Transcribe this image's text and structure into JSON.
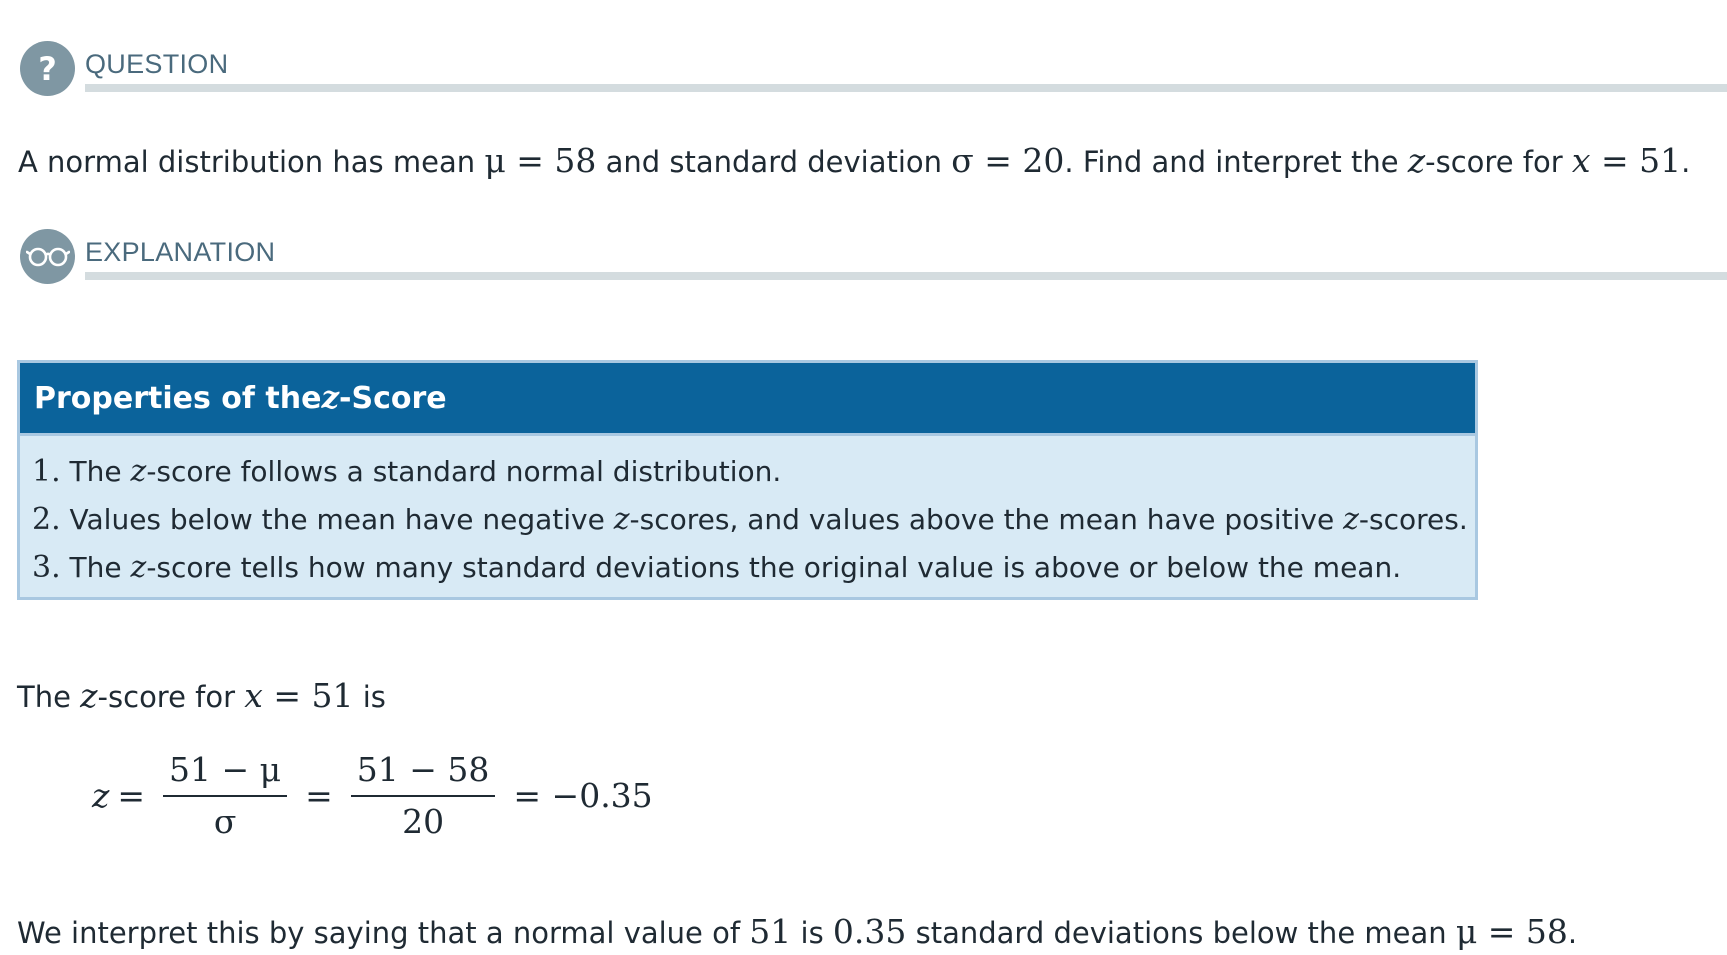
{
  "question": {
    "header": "QUESTION",
    "icon": "question-mark-icon",
    "text": {
      "part1": "A normal distribution has mean ",
      "mu_eq": "μ = 58",
      "part2": " and standard deviation ",
      "sigma_eq": "σ = 20",
      "part3": ". Find and interpret the ",
      "z": "z",
      "part4": "-score for ",
      "x": "x",
      "x_eq": " = 51",
      "part5": "."
    }
  },
  "explanation": {
    "header": "EXPLANATION",
    "icon": "glasses-icon"
  },
  "properties_box": {
    "title_prefix": "Properties of the ",
    "title_z": "z",
    "title_suffix": "-Score",
    "items": [
      {
        "num": "1.",
        "a": " The ",
        "z1": "z",
        "b": "-score follows a standard normal distribution."
      },
      {
        "num": "2.",
        "a": " Values below the mean have negative ",
        "z1": "z",
        "b": "-scores, and values above the mean have positive ",
        "z2": "z",
        "c": "-scores."
      },
      {
        "num": "3.",
        "a": " The ",
        "z1": "z",
        "b": "-score tells how many standard deviations the original value is above or below the mean."
      }
    ]
  },
  "intro": {
    "a": "The ",
    "z": "z",
    "b": "-score for ",
    "x": "x",
    "x_eq": " = 51",
    "c": " is"
  },
  "equation": {
    "lhs": "z",
    "eq": "=",
    "frac1_num": "51 − μ",
    "frac1_den": "σ",
    "frac2_num": "51 − 58",
    "frac2_den": "20",
    "result": "= −0.35"
  },
  "interpretation": {
    "a": "We interpret this by saying that a normal value of ",
    "value": "51",
    "b": " is ",
    "sd": "0.35",
    "c": " standard deviations below the mean ",
    "mu_eq": "μ = 58",
    "d": "."
  },
  "colors": {
    "badge": "#7f97a3",
    "header_text": "#4a6a7d",
    "rule": "#d4dcdf",
    "box_title_bg": "#0b639b",
    "box_bg": "#d8eaf5",
    "box_border": "#a9c8e1"
  }
}
